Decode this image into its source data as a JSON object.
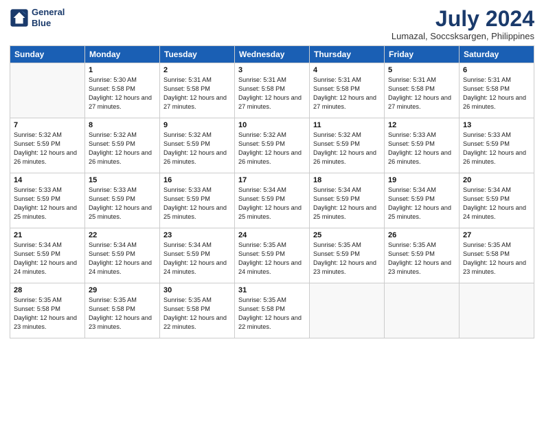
{
  "logo": {
    "line1": "General",
    "line2": "Blue"
  },
  "title": "July 2024",
  "location": "Lumazal, Soccsksargen, Philippines",
  "headers": [
    "Sunday",
    "Monday",
    "Tuesday",
    "Wednesday",
    "Thursday",
    "Friday",
    "Saturday"
  ],
  "weeks": [
    [
      {
        "day": "",
        "sunrise": "",
        "sunset": "",
        "daylight": ""
      },
      {
        "day": "1",
        "sunrise": "Sunrise: 5:30 AM",
        "sunset": "Sunset: 5:58 PM",
        "daylight": "Daylight: 12 hours and 27 minutes."
      },
      {
        "day": "2",
        "sunrise": "Sunrise: 5:31 AM",
        "sunset": "Sunset: 5:58 PM",
        "daylight": "Daylight: 12 hours and 27 minutes."
      },
      {
        "day": "3",
        "sunrise": "Sunrise: 5:31 AM",
        "sunset": "Sunset: 5:58 PM",
        "daylight": "Daylight: 12 hours and 27 minutes."
      },
      {
        "day": "4",
        "sunrise": "Sunrise: 5:31 AM",
        "sunset": "Sunset: 5:58 PM",
        "daylight": "Daylight: 12 hours and 27 minutes."
      },
      {
        "day": "5",
        "sunrise": "Sunrise: 5:31 AM",
        "sunset": "Sunset: 5:58 PM",
        "daylight": "Daylight: 12 hours and 27 minutes."
      },
      {
        "day": "6",
        "sunrise": "Sunrise: 5:31 AM",
        "sunset": "Sunset: 5:58 PM",
        "daylight": "Daylight: 12 hours and 26 minutes."
      }
    ],
    [
      {
        "day": "7",
        "sunrise": "Sunrise: 5:32 AM",
        "sunset": "Sunset: 5:59 PM",
        "daylight": "Daylight: 12 hours and 26 minutes."
      },
      {
        "day": "8",
        "sunrise": "Sunrise: 5:32 AM",
        "sunset": "Sunset: 5:59 PM",
        "daylight": "Daylight: 12 hours and 26 minutes."
      },
      {
        "day": "9",
        "sunrise": "Sunrise: 5:32 AM",
        "sunset": "Sunset: 5:59 PM",
        "daylight": "Daylight: 12 hours and 26 minutes."
      },
      {
        "day": "10",
        "sunrise": "Sunrise: 5:32 AM",
        "sunset": "Sunset: 5:59 PM",
        "daylight": "Daylight: 12 hours and 26 minutes."
      },
      {
        "day": "11",
        "sunrise": "Sunrise: 5:32 AM",
        "sunset": "Sunset: 5:59 PM",
        "daylight": "Daylight: 12 hours and 26 minutes."
      },
      {
        "day": "12",
        "sunrise": "Sunrise: 5:33 AM",
        "sunset": "Sunset: 5:59 PM",
        "daylight": "Daylight: 12 hours and 26 minutes."
      },
      {
        "day": "13",
        "sunrise": "Sunrise: 5:33 AM",
        "sunset": "Sunset: 5:59 PM",
        "daylight": "Daylight: 12 hours and 26 minutes."
      }
    ],
    [
      {
        "day": "14",
        "sunrise": "Sunrise: 5:33 AM",
        "sunset": "Sunset: 5:59 PM",
        "daylight": "Daylight: 12 hours and 25 minutes."
      },
      {
        "day": "15",
        "sunrise": "Sunrise: 5:33 AM",
        "sunset": "Sunset: 5:59 PM",
        "daylight": "Daylight: 12 hours and 25 minutes."
      },
      {
        "day": "16",
        "sunrise": "Sunrise: 5:33 AM",
        "sunset": "Sunset: 5:59 PM",
        "daylight": "Daylight: 12 hours and 25 minutes."
      },
      {
        "day": "17",
        "sunrise": "Sunrise: 5:34 AM",
        "sunset": "Sunset: 5:59 PM",
        "daylight": "Daylight: 12 hours and 25 minutes."
      },
      {
        "day": "18",
        "sunrise": "Sunrise: 5:34 AM",
        "sunset": "Sunset: 5:59 PM",
        "daylight": "Daylight: 12 hours and 25 minutes."
      },
      {
        "day": "19",
        "sunrise": "Sunrise: 5:34 AM",
        "sunset": "Sunset: 5:59 PM",
        "daylight": "Daylight: 12 hours and 25 minutes."
      },
      {
        "day": "20",
        "sunrise": "Sunrise: 5:34 AM",
        "sunset": "Sunset: 5:59 PM",
        "daylight": "Daylight: 12 hours and 24 minutes."
      }
    ],
    [
      {
        "day": "21",
        "sunrise": "Sunrise: 5:34 AM",
        "sunset": "Sunset: 5:59 PM",
        "daylight": "Daylight: 12 hours and 24 minutes."
      },
      {
        "day": "22",
        "sunrise": "Sunrise: 5:34 AM",
        "sunset": "Sunset: 5:59 PM",
        "daylight": "Daylight: 12 hours and 24 minutes."
      },
      {
        "day": "23",
        "sunrise": "Sunrise: 5:34 AM",
        "sunset": "Sunset: 5:59 PM",
        "daylight": "Daylight: 12 hours and 24 minutes."
      },
      {
        "day": "24",
        "sunrise": "Sunrise: 5:35 AM",
        "sunset": "Sunset: 5:59 PM",
        "daylight": "Daylight: 12 hours and 24 minutes."
      },
      {
        "day": "25",
        "sunrise": "Sunrise: 5:35 AM",
        "sunset": "Sunset: 5:59 PM",
        "daylight": "Daylight: 12 hours and 23 minutes."
      },
      {
        "day": "26",
        "sunrise": "Sunrise: 5:35 AM",
        "sunset": "Sunset: 5:59 PM",
        "daylight": "Daylight: 12 hours and 23 minutes."
      },
      {
        "day": "27",
        "sunrise": "Sunrise: 5:35 AM",
        "sunset": "Sunset: 5:58 PM",
        "daylight": "Daylight: 12 hours and 23 minutes."
      }
    ],
    [
      {
        "day": "28",
        "sunrise": "Sunrise: 5:35 AM",
        "sunset": "Sunset: 5:58 PM",
        "daylight": "Daylight: 12 hours and 23 minutes."
      },
      {
        "day": "29",
        "sunrise": "Sunrise: 5:35 AM",
        "sunset": "Sunset: 5:58 PM",
        "daylight": "Daylight: 12 hours and 23 minutes."
      },
      {
        "day": "30",
        "sunrise": "Sunrise: 5:35 AM",
        "sunset": "Sunset: 5:58 PM",
        "daylight": "Daylight: 12 hours and 22 minutes."
      },
      {
        "day": "31",
        "sunrise": "Sunrise: 5:35 AM",
        "sunset": "Sunset: 5:58 PM",
        "daylight": "Daylight: 12 hours and 22 minutes."
      },
      {
        "day": "",
        "sunrise": "",
        "sunset": "",
        "daylight": ""
      },
      {
        "day": "",
        "sunrise": "",
        "sunset": "",
        "daylight": ""
      },
      {
        "day": "",
        "sunrise": "",
        "sunset": "",
        "daylight": ""
      }
    ]
  ]
}
